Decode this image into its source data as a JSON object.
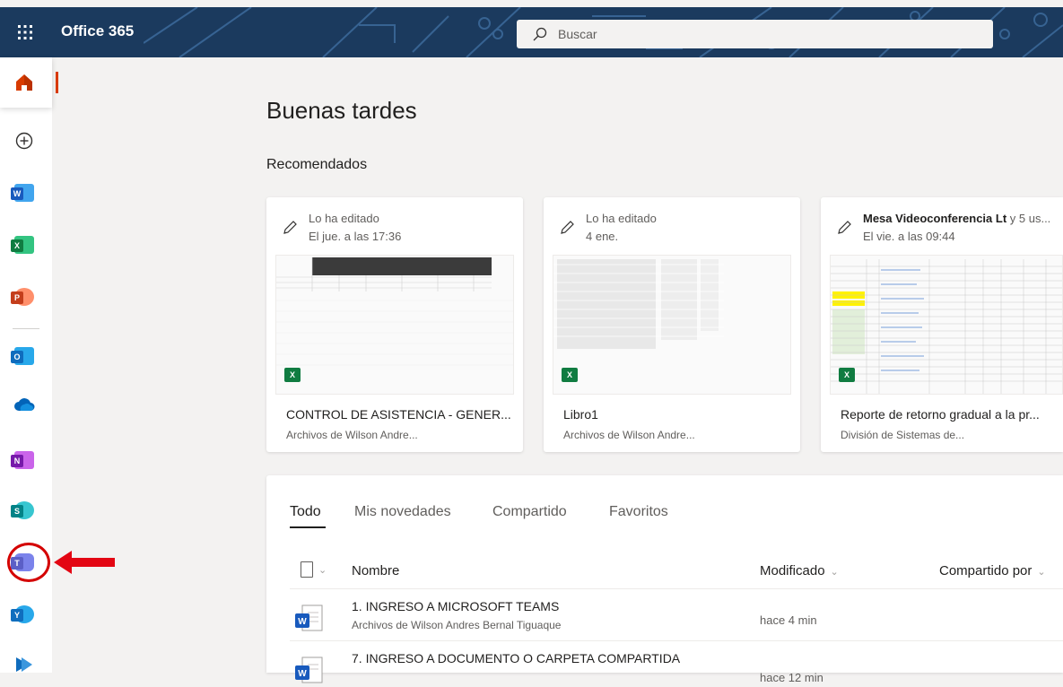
{
  "header": {
    "brand": "Office 365",
    "search_placeholder": "Buscar"
  },
  "nav": {
    "apps": [
      {
        "name": "home",
        "letter": ""
      },
      {
        "name": "create",
        "letter": ""
      },
      {
        "name": "word",
        "letter": "W",
        "color": "#185abd"
      },
      {
        "name": "excel",
        "letter": "X",
        "color": "#107c41"
      },
      {
        "name": "powerpoint",
        "letter": "P",
        "color": "#c43e1c"
      },
      {
        "name": "outlook",
        "letter": "O",
        "color": "#0f6cbd"
      },
      {
        "name": "onedrive",
        "letter": "",
        "color": "#0364b8"
      },
      {
        "name": "onenote",
        "letter": "N",
        "color": "#7719aa"
      },
      {
        "name": "sharepoint",
        "letter": "S",
        "color": "#038387"
      },
      {
        "name": "teams",
        "letter": "T",
        "color": "#5b5fc7"
      },
      {
        "name": "yammer",
        "letter": "Y",
        "color": "#106ebe"
      }
    ]
  },
  "main": {
    "greeting": "Buenas tardes",
    "recommended_title": "Recomendados"
  },
  "cards": [
    {
      "meta1": "Lo ha editado",
      "meta2": "El jue. a las 17:36",
      "name": "CONTROL DE ASISTENCIA - GENER...",
      "location": "Archivos de Wilson Andre..."
    },
    {
      "meta1": "Lo ha editado",
      "meta2": "4 ene.",
      "name": "Libro1",
      "location": "Archivos de Wilson Andre..."
    },
    {
      "meta1_bold": "Mesa Videoconferencia Lt",
      "meta1": " y 5 us...",
      "meta2": "El vie. a las 09:44",
      "name": "Reporte de retorno gradual a la pr...",
      "location": "División de Sistemas de..."
    }
  ],
  "files": {
    "tabs": [
      "Todo",
      "Mis novedades",
      "Compartido",
      "Favoritos"
    ],
    "columns": {
      "name": "Nombre",
      "modified": "Modificado",
      "shared_by": "Compartido por"
    },
    "rows": [
      {
        "name": "1. INGRESO A MICROSOFT TEAMS",
        "location": "Archivos de Wilson Andres Bernal Tiguaque",
        "modified": "hace 4 min"
      },
      {
        "name": "7. INGRESO A DOCUMENTO O CARPETA COMPARTIDA",
        "location": "",
        "modified": "hace 12 min"
      }
    ]
  },
  "colors": {
    "accent": "#d83b01",
    "highlight": "#d40000",
    "topbar": "#1b3a5e"
  }
}
